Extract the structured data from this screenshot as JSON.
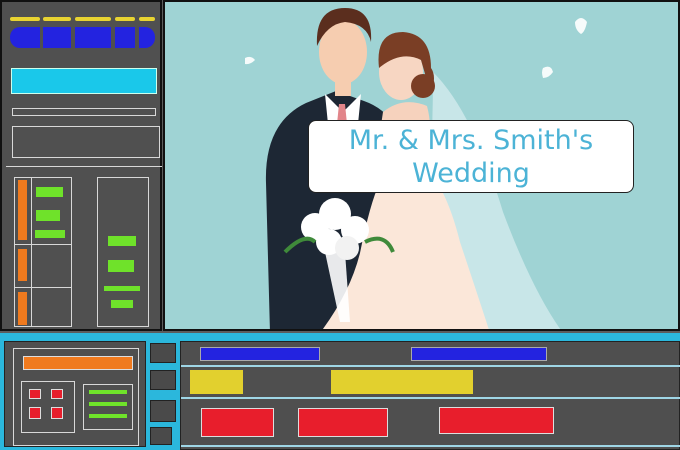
{
  "title_card": {
    "line1": "Mr. & Mrs. Smith's",
    "line2": "Wedding"
  },
  "colors": {
    "panel": "#505050",
    "accent_yellow": "#e8d331",
    "accent_blue": "#2323e0",
    "accent_cyan": "#1ac8ea",
    "accent_orange": "#f07a1e",
    "accent_green": "#6fe22a",
    "accent_red": "#e81e2c",
    "preview_bg": "#9fd3d4",
    "title_text": "#4cb3d6"
  },
  "icons": [
    "toolbar-button",
    "timeline-tool-button"
  ]
}
